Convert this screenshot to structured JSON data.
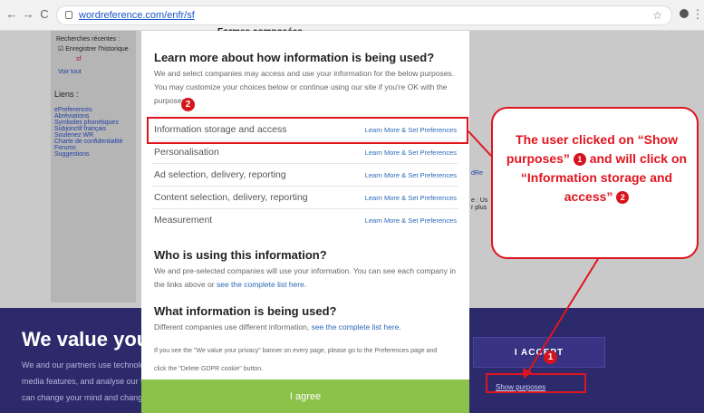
{
  "browser": {
    "url": "wordreference.com/enfr/sf",
    "back_glyph": "←",
    "forward_glyph": "→",
    "reload_glyph": "C",
    "star_glyph": "☆",
    "menu_glyph": "⋮"
  },
  "background_page": {
    "top_heading": "Formes composées",
    "recent_label": "Recherches récentes :",
    "save_history": "Enregistrer l'historique",
    "recent_item": "sf",
    "see_all": "Voir tout",
    "links_heading": "Liens :",
    "links": [
      "ePreferences",
      "Abréviations",
      "Symboles phonétiques",
      "Subjonctif français",
      "Soutenez WR",
      "Charte de confidentialité",
      "Forums",
      "Suggestions"
    ],
    "right_fragments": [
      "dRe",
      "e : Us",
      "r plus"
    ]
  },
  "banner": {
    "title": "We value your p",
    "lines": [
      "We and our partners use technolog",
      "media features, and analyse our tra",
      "can change your mind and change"
    ],
    "accept_label": "I ACCEPT",
    "show_purposes_label": "Show purposes"
  },
  "modal": {
    "heading1": "Learn more about how information is being used?",
    "intro": "We and select companies may access and use your information for the below purposes. You may customize your choices below or continue using our site if you're OK with the purposes.",
    "purposes": [
      {
        "label": "Information storage and access",
        "link": "Learn More & Set Preferences"
      },
      {
        "label": "Personalisation",
        "link": "Learn More & Set Preferences"
      },
      {
        "label": "Ad selection, delivery, reporting",
        "link": "Learn More & Set Preferences"
      },
      {
        "label": "Content selection, delivery, reporting",
        "link": "Learn More & Set Preferences"
      },
      {
        "label": "Measurement",
        "link": "Learn More & Set Preferences"
      }
    ],
    "heading2": "Who is using this information?",
    "who_text": "We and pre-selected companies will use your information. You can see each company in the links above or ",
    "who_link": "see the complete list here.",
    "heading3": "What information is being used?",
    "what_text": "Different companies use different information, ",
    "what_link": "see the complete list here.",
    "gdpr_note_1": "If you see the \"We value your privacy\" banner on every page, please go to the Preferences page and",
    "gdpr_note_2": "click the \"Delete GDPR cookie\" button.",
    "agree_label": "I agree"
  },
  "annotation": {
    "badge1": "1",
    "badge2": "2",
    "callout_parts": [
      "The user clicked on “Show purposes” ",
      " and will click on “Information storage and access” "
    ],
    "accent_color": "#e0141e"
  }
}
